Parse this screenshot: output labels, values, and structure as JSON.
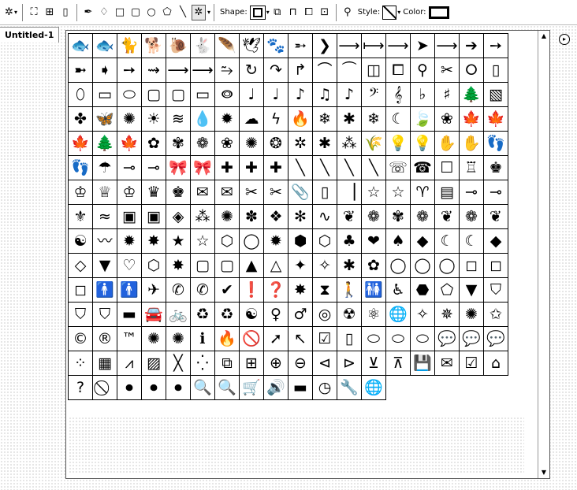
{
  "toolbar": {
    "shape_label": "Shape:",
    "style_label": "Style:",
    "color_label": "Color:"
  },
  "document": {
    "tab_title": "Untitled-1"
  },
  "shapes": [
    "🐟",
    "🐟",
    "🐈",
    "🐕",
    "🐌",
    "🐇",
    "🪶",
    "🕊",
    "🐾",
    "➵",
    "❯",
    "⟶",
    "⟼",
    "⟶",
    "➤",
    "⟶",
    "➔",
    "➙",
    "➼",
    "➧",
    "➙",
    "⇝",
    "⟶",
    "⟶",
    "⥲",
    "↻",
    "↷",
    "↱",
    "⌒",
    "⏜",
    "◫",
    "⧠",
    "⚲",
    "✂",
    "⭘",
    "▯",
    "⬯",
    "▭",
    "⬭",
    "▢",
    "▢",
    "▭",
    "⭖",
    "♩",
    "♩",
    "♪",
    "♫",
    "♪",
    "𝄢",
    "𝄞",
    "♭",
    "♯",
    "🌲",
    "▧",
    "✤",
    "🦋",
    "✺",
    "☀",
    "≋",
    "💧",
    "✹",
    "☁",
    "ϟ",
    "🔥",
    "❄",
    "✱",
    "❄",
    "☾",
    "🍃",
    "❀",
    "🍁",
    "🍁",
    "🍁",
    "🌲",
    "🍁",
    "✿",
    "✾",
    "❁",
    "❀",
    "✺",
    "❂",
    "✲",
    "✱",
    "⁂",
    "🌾",
    "💡",
    "💡",
    "✋",
    "✋",
    "👣",
    "👣",
    "☂",
    "⊸",
    "⊸",
    "🎀",
    "🎀",
    "✚",
    "✚",
    "✚",
    "╲",
    "╲",
    "╲",
    "╲",
    "☏",
    "☎",
    "☐",
    "♖",
    "♚",
    "♔",
    "♕",
    "♔",
    "♛",
    "♚",
    "✉",
    "✉",
    "✂",
    "✂",
    "📎",
    "▯",
    "▕",
    "☆",
    "☆",
    "♈",
    "▤",
    "⊸",
    "⊸",
    "⚜",
    "≈",
    "▣",
    "▣",
    "◈",
    "⁂",
    "✺",
    "✽",
    "❖",
    "✻",
    "∿",
    "❦",
    "❁",
    "✾",
    "❁",
    "❦",
    "❁",
    "❦",
    "☯",
    "〰",
    "✹",
    "✸",
    "★",
    "☆",
    "⬡",
    "◯",
    "✹",
    "⬢",
    "⬡",
    "♣",
    "❤",
    "♠",
    "◆",
    "☾",
    "☾",
    "◆",
    "◇",
    "▼",
    "♡",
    "⬡",
    "✸",
    "▢",
    "▢",
    "▲",
    "△",
    "✦",
    "✧",
    "✱",
    "✿",
    "◯",
    "◯",
    "◯",
    "◻",
    "◻",
    "◻",
    "🚹",
    "🚹",
    "✈",
    "✆",
    "✆",
    "✔",
    "❗",
    "❓",
    "✸",
    "⧗",
    "🚶",
    "🚻",
    "♿",
    "⬣",
    "⬠",
    "▼",
    "⛉",
    "⛉",
    "⛉",
    "▬",
    "🚘",
    "🚲",
    "♻",
    "♻",
    "☯",
    "♀",
    "♂",
    "◎",
    "☢",
    "⚛",
    "🌐",
    "✧",
    "✵",
    "✺",
    "✩",
    "©",
    "®",
    "™",
    "✺",
    "✺",
    "ℹ",
    "🔥",
    "🚫",
    "➚",
    "↖",
    "☑",
    "▯",
    "⬭",
    "⬭",
    "⬭",
    "💬",
    "💬",
    "💬",
    "⁘",
    "▦",
    "⩘",
    "▨",
    "╳",
    "⁛",
    "⧉",
    "⊞",
    "⊕",
    "⊖",
    "⊲",
    "⊳",
    "⊻",
    "⊼",
    "💾",
    "✉",
    "☑",
    "⌂",
    "?",
    "⃠",
    "⏺",
    "⏺",
    "⏺",
    "🔍",
    "🔍",
    "🛒",
    "🔊",
    "▬",
    "◷",
    "🔧",
    "🌐"
  ]
}
